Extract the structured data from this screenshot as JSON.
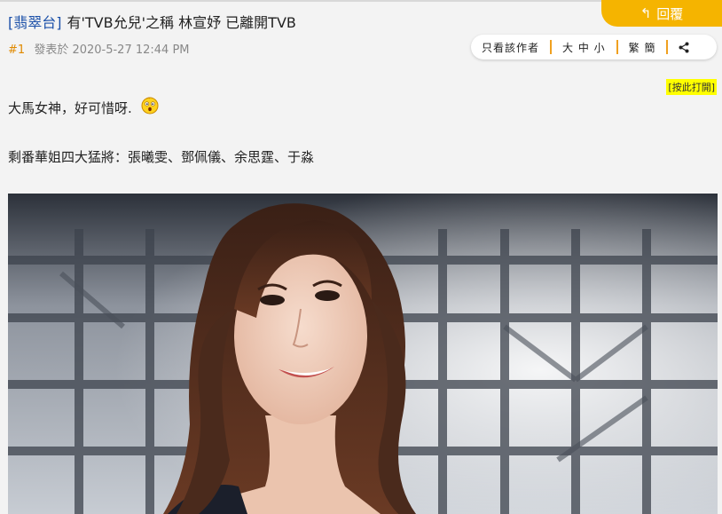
{
  "header": {
    "reply_label": "回覆",
    "forum_tag": "[翡翠台]",
    "thread_title": "有'TVB允兒'之稱 林宣妤 已離開TVB"
  },
  "post": {
    "floor": "#1",
    "posted_at": "發表於 2020-5-27 12:44 PM",
    "line1": "大馬女神，好可惜呀.",
    "line2": "剩番華姐四大猛將：張曦雯、鄧佩儀、余思霆、于淼",
    "expand_link": "[按此打開]"
  },
  "toolbar": {
    "author_only": "只看該作者",
    "font_size": "大 中 小",
    "traditional_simplified": "繁 簡",
    "share_icon": "share-icon"
  },
  "colors": {
    "accent": "#f5b400",
    "link": "#1a4fa8",
    "floor": "#e08a00",
    "separator": "#f0a020",
    "highlight": "#ffff00"
  }
}
